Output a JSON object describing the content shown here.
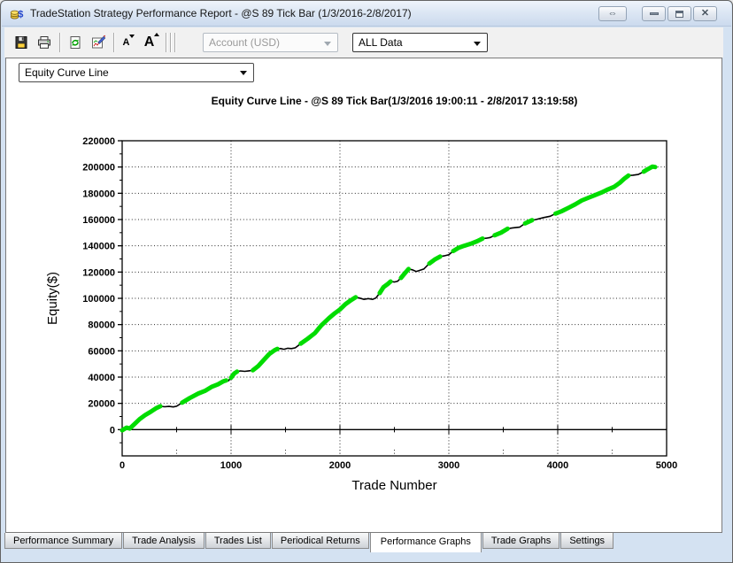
{
  "window": {
    "title": "TradeStation Strategy Performance Report - @S 89 Tick Bar (1/3/2016-2/8/2017)",
    "app_icon": "coins-dollar-icon",
    "controls": {
      "expand_glyph": "⇔",
      "close_glyph": "✕"
    }
  },
  "toolbar": {
    "icons": [
      "save-icon",
      "print-icon",
      "refresh-icon",
      "format-icon",
      "decrease-font-icon",
      "increase-font-icon"
    ],
    "decrease_font_glyph": "A",
    "increase_font_glyph": "A",
    "account_selector": {
      "value": "Account (USD)",
      "disabled": true
    },
    "interval_selector": {
      "value": "ALL Data",
      "disabled": false
    }
  },
  "report": {
    "graph_selector": {
      "value": "Equity Curve Line"
    }
  },
  "chart_data": {
    "type": "line",
    "title": "Equity Curve Line - @S 89 Tick Bar(1/3/2016 19:00:11 - 2/8/2017 13:19:58)",
    "xlabel": "Trade Number",
    "ylabel": "Equity($)",
    "xlim": [
      0,
      5000
    ],
    "ylim": [
      -20000,
      220000
    ],
    "x_ticks": [
      0,
      1000,
      2000,
      3000,
      4000,
      5000
    ],
    "y_ticks": [
      0,
      20000,
      40000,
      60000,
      80000,
      100000,
      120000,
      140000,
      160000,
      180000,
      200000,
      220000
    ],
    "x_minor_step": 500,
    "y_minor_step": 10000,
    "grid": "dotted",
    "legend": "none",
    "series": [
      {
        "name": "Equity",
        "color": "#00DC00",
        "drawdown_color": "#000000",
        "note": "points are [trade_number, equity_dollars, segment] where segment 1 = green (new-high run), 0 = black (flat/drawdown run)",
        "points": [
          [
            0,
            -500,
            1
          ],
          [
            40,
            1500,
            1
          ],
          [
            70,
            800,
            1
          ],
          [
            110,
            4000,
            1
          ],
          [
            160,
            8000,
            1
          ],
          [
            210,
            11000,
            1
          ],
          [
            260,
            13500,
            1
          ],
          [
            310,
            16200,
            1
          ],
          [
            350,
            17800,
            1
          ],
          [
            390,
            17400,
            0
          ],
          [
            430,
            17700,
            0
          ],
          [
            470,
            17300,
            0
          ],
          [
            500,
            17800,
            0
          ],
          [
            550,
            20500,
            1
          ],
          [
            620,
            24000,
            1
          ],
          [
            700,
            27500,
            1
          ],
          [
            760,
            29500,
            1
          ],
          [
            820,
            32500,
            1
          ],
          [
            880,
            34500,
            1
          ],
          [
            930,
            36800,
            1
          ],
          [
            955,
            37500,
            1
          ],
          [
            975,
            37200,
            0
          ],
          [
            1000,
            39500,
            1
          ],
          [
            1030,
            42800,
            1
          ],
          [
            1055,
            44200,
            1
          ],
          [
            1085,
            44700,
            0
          ],
          [
            1125,
            44400,
            0
          ],
          [
            1165,
            44800,
            0
          ],
          [
            1200,
            45200,
            1
          ],
          [
            1250,
            48500,
            1
          ],
          [
            1300,
            53000,
            1
          ],
          [
            1350,
            57500,
            1
          ],
          [
            1400,
            60500,
            1
          ],
          [
            1425,
            61500,
            1
          ],
          [
            1455,
            61800,
            0
          ],
          [
            1485,
            61200,
            0
          ],
          [
            1520,
            62000,
            0
          ],
          [
            1555,
            61700,
            0
          ],
          [
            1590,
            62300,
            0
          ],
          [
            1640,
            65500,
            1
          ],
          [
            1700,
            69000,
            1
          ],
          [
            1770,
            73500,
            1
          ],
          [
            1830,
            79500,
            1
          ],
          [
            1900,
            85000,
            1
          ],
          [
            1950,
            88500,
            1
          ],
          [
            2000,
            91500,
            1
          ],
          [
            2050,
            95500,
            1
          ],
          [
            2100,
            98500,
            1
          ],
          [
            2145,
            100800,
            1
          ],
          [
            2180,
            100200,
            0
          ],
          [
            2220,
            99200,
            0
          ],
          [
            2260,
            99800,
            0
          ],
          [
            2300,
            99200,
            0
          ],
          [
            2330,
            100300,
            0
          ],
          [
            2365,
            104000,
            1
          ],
          [
            2400,
            108500,
            1
          ],
          [
            2440,
            111000,
            1
          ],
          [
            2465,
            112800,
            1
          ],
          [
            2500,
            112400,
            0
          ],
          [
            2530,
            113000,
            0
          ],
          [
            2560,
            115500,
            1
          ],
          [
            2600,
            119500,
            1
          ],
          [
            2630,
            122300,
            1
          ],
          [
            2665,
            121700,
            0
          ],
          [
            2700,
            120400,
            0
          ],
          [
            2740,
            121500,
            0
          ],
          [
            2770,
            122300,
            0
          ],
          [
            2820,
            126500,
            1
          ],
          [
            2870,
            129500,
            1
          ],
          [
            2920,
            131800,
            1
          ],
          [
            2955,
            132300,
            0
          ],
          [
            3000,
            133200,
            0
          ],
          [
            3040,
            136000,
            1
          ],
          [
            3090,
            138500,
            1
          ],
          [
            3140,
            140000,
            1
          ],
          [
            3200,
            141500,
            1
          ],
          [
            3260,
            143500,
            1
          ],
          [
            3310,
            145500,
            1
          ],
          [
            3345,
            145800,
            0
          ],
          [
            3380,
            146300,
            0
          ],
          [
            3420,
            148000,
            1
          ],
          [
            3480,
            150000,
            1
          ],
          [
            3540,
            153000,
            1
          ],
          [
            3580,
            153500,
            0
          ],
          [
            3650,
            154200,
            0
          ],
          [
            3700,
            157000,
            1
          ],
          [
            3765,
            159500,
            1
          ],
          [
            3800,
            160000,
            0
          ],
          [
            3870,
            161500,
            0
          ],
          [
            3930,
            162500,
            0
          ],
          [
            3980,
            164500,
            1
          ],
          [
            4040,
            166500,
            1
          ],
          [
            4100,
            169000,
            1
          ],
          [
            4160,
            171500,
            1
          ],
          [
            4220,
            174500,
            1
          ],
          [
            4280,
            176500,
            1
          ],
          [
            4340,
            178500,
            1
          ],
          [
            4400,
            180500,
            1
          ],
          [
            4450,
            182500,
            1
          ],
          [
            4520,
            185000,
            1
          ],
          [
            4570,
            188000,
            1
          ],
          [
            4610,
            191000,
            1
          ],
          [
            4650,
            193500,
            1
          ],
          [
            4690,
            193800,
            0
          ],
          [
            4740,
            194300,
            0
          ],
          [
            4790,
            196500,
            1
          ],
          [
            4830,
            198500,
            1
          ],
          [
            4870,
            200300,
            1
          ],
          [
            4895,
            200000,
            1
          ]
        ]
      }
    ]
  },
  "tabs": {
    "active_index": 4,
    "items": [
      "Performance Summary",
      "Trade Analysis",
      "Trades List",
      "Periodical Returns",
      "Performance Graphs",
      "Trade Graphs",
      "Settings"
    ]
  }
}
